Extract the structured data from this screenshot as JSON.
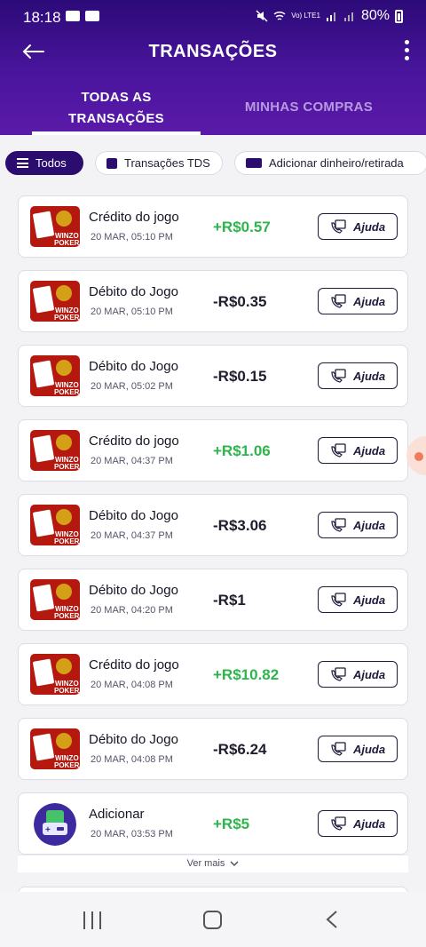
{
  "status_bar": {
    "time": "18:18",
    "network": "Vo) LTE1",
    "battery": "80%"
  },
  "header": {
    "title": "TRANSAÇÕES"
  },
  "tabs": [
    {
      "label": "TODAS AS TRANSAÇÕES",
      "active": true
    },
    {
      "label": "MINHAS COMPRAS",
      "active": false
    }
  ],
  "filters": [
    {
      "label": "Todos",
      "active": true,
      "icon": "list-icon"
    },
    {
      "label": "Transações TDS",
      "active": false,
      "icon": "document-icon"
    },
    {
      "label": "Adicionar dinheiro/retirada",
      "active": false,
      "icon": "money-icon"
    }
  ],
  "transactions": [
    {
      "title": "Crédito do jogo",
      "date": "20 MAR, 05:10 PM",
      "amount": "+R$0.57",
      "positive": true,
      "icon": "winzo-poker-icon"
    },
    {
      "title": "Débito do Jogo",
      "date": "20 MAR, 05:10 PM",
      "amount": "-R$0.35",
      "positive": false,
      "icon": "winzo-poker-icon"
    },
    {
      "title": "Débito do Jogo",
      "date": "20 MAR, 05:02 PM",
      "amount": "-R$0.15",
      "positive": false,
      "icon": "winzo-poker-icon"
    },
    {
      "title": "Crédito do jogo",
      "date": "20 MAR, 04:37 PM",
      "amount": "+R$1.06",
      "positive": true,
      "icon": "winzo-poker-icon"
    },
    {
      "title": "Débito do Jogo",
      "date": "20 MAR, 04:37 PM",
      "amount": "-R$3.06",
      "positive": false,
      "icon": "winzo-poker-icon"
    },
    {
      "title": "Débito do Jogo",
      "date": "20 MAR, 04:20 PM",
      "amount": "-R$1",
      "positive": false,
      "icon": "winzo-poker-icon"
    },
    {
      "title": "Crédito do jogo",
      "date": "20 MAR, 04:08 PM",
      "amount": "+R$10.82",
      "positive": true,
      "icon": "winzo-poker-icon"
    },
    {
      "title": "Débito do Jogo",
      "date": "20 MAR, 04:08 PM",
      "amount": "-R$6.24",
      "positive": false,
      "icon": "winzo-poker-icon"
    },
    {
      "title": "Adicionar",
      "date": "20 MAR, 03:53 PM",
      "amount": "+R$5",
      "positive": true,
      "icon": "add-money-icon"
    }
  ],
  "help_label": "Ajuda",
  "see_more": "Ver mais",
  "colors": {
    "header": "#4a159d",
    "positive": "#2fb54d",
    "active_chip": "#2a0d6e"
  }
}
